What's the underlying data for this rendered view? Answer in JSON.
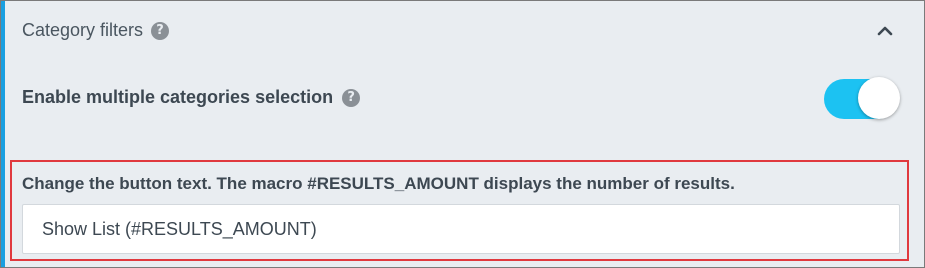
{
  "section": {
    "title": "Category filters",
    "help_icon": "question-circle-icon",
    "collapse_icon": "chevron-up-icon"
  },
  "multiple_categories": {
    "label": "Enable multiple categories selection",
    "help_icon": "question-circle-icon",
    "enabled": true
  },
  "button_text": {
    "label": "Change the button text. The macro #RESULTS_AMOUNT displays the number of results.",
    "value": "Show List (#RESULTS_AMOUNT)"
  },
  "colors": {
    "accent": "#1a9fe0",
    "toggle_on": "#1cc2f2",
    "highlight": "#e0393e",
    "panel_background": "#e9edf1"
  }
}
